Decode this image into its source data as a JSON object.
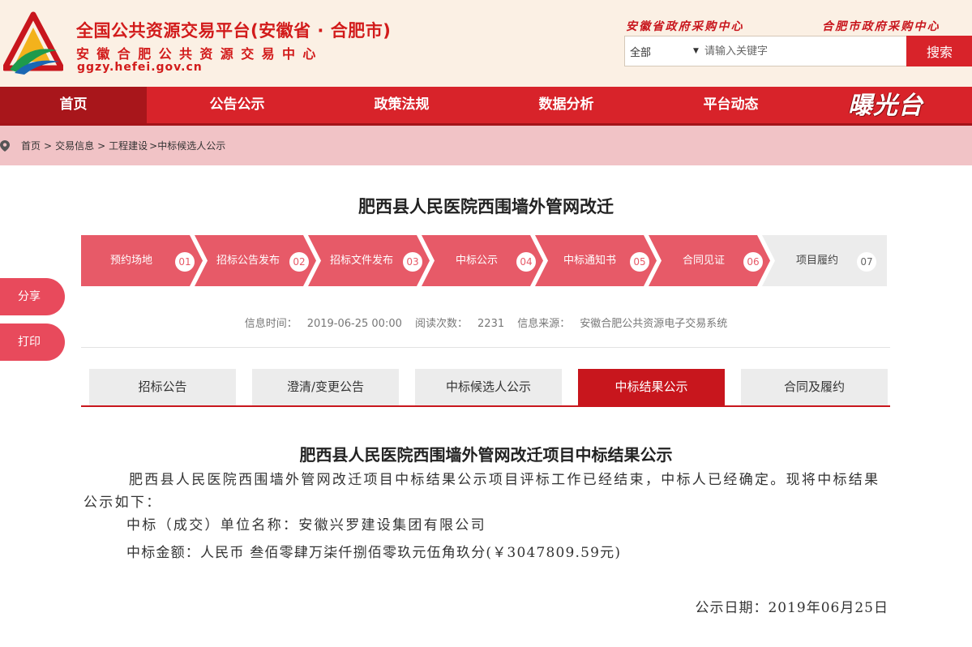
{
  "colors": {
    "brand_red": "#d8232a",
    "nav_active": "#a8161b",
    "breadcrumb_bg": "#f1c3c6",
    "step_done": "#e75a68",
    "step_todo": "#ececec",
    "tab_active": "#c8161d",
    "header_bg": "#fbf0e4"
  },
  "header": {
    "title": "全国公共资源交易平台(安徽省 · 合肥市)",
    "subtitle": "安徽合肥公共资源交易中心",
    "url": "ggzy.hefei.gov.cn",
    "links": [
      "安徽省政府采购中心",
      "合肥市政府采购中心"
    ],
    "logo_icon": "triangle-logo-icon"
  },
  "search": {
    "scope": "全部",
    "placeholder": "请输入关键字",
    "button": "搜索"
  },
  "nav": {
    "items": [
      "首页",
      "公告公示",
      "政策法规",
      "数据分析",
      "平台动态"
    ],
    "active_index": 0,
    "brand": "曝光台"
  },
  "breadcrumb": {
    "icon": "location-pin-icon",
    "items": [
      "首页",
      "交易信息",
      "工程建设",
      "中标候选人公示"
    ],
    "sep": ">"
  },
  "page_title": "肥西县人民医院西围墙外管网改迁",
  "steps": [
    {
      "label": "预约场地",
      "num": "01",
      "done": true
    },
    {
      "label": "招标公告发布",
      "num": "02",
      "done": true
    },
    {
      "label": "招标文件发布",
      "num": "03",
      "done": true
    },
    {
      "label": "中标公示",
      "num": "04",
      "done": true
    },
    {
      "label": "中标通知书",
      "num": "05",
      "done": true
    },
    {
      "label": "合同见证",
      "num": "06",
      "done": true
    },
    {
      "label": "项目履约",
      "num": "07",
      "done": false
    }
  ],
  "side": {
    "share": "分享",
    "print": "打印"
  },
  "meta": {
    "time_label": "信息时间：",
    "time": "2019-06-25 00:00",
    "views_label": "阅读次数：",
    "views": "2231",
    "source_label": "信息来源：",
    "source": "安徽合肥公共资源电子交易系统"
  },
  "tabs": {
    "items": [
      "招标公告",
      "澄清/变更公告",
      "中标候选人公示",
      "中标结果公示",
      "合同及履约"
    ],
    "active_index": 3
  },
  "notice": {
    "title": "肥西县人民医院西围墙外管网改迁项目中标结果公示",
    "p1": "肥西县人民医院西围墙外管网改迁项目中标结果公示项目评标工作已经结束，中标人已经确定。现将中标结果公示如下：",
    "p2": "中标（成交）单位名称：安徽兴罗建设集团有限公司",
    "p3": "中标金额：人民币 叁佰零肆万柒仟捌佰零玖元伍角玖分(￥3047809.59元)",
    "date": "公示日期：2019年06月25日"
  }
}
